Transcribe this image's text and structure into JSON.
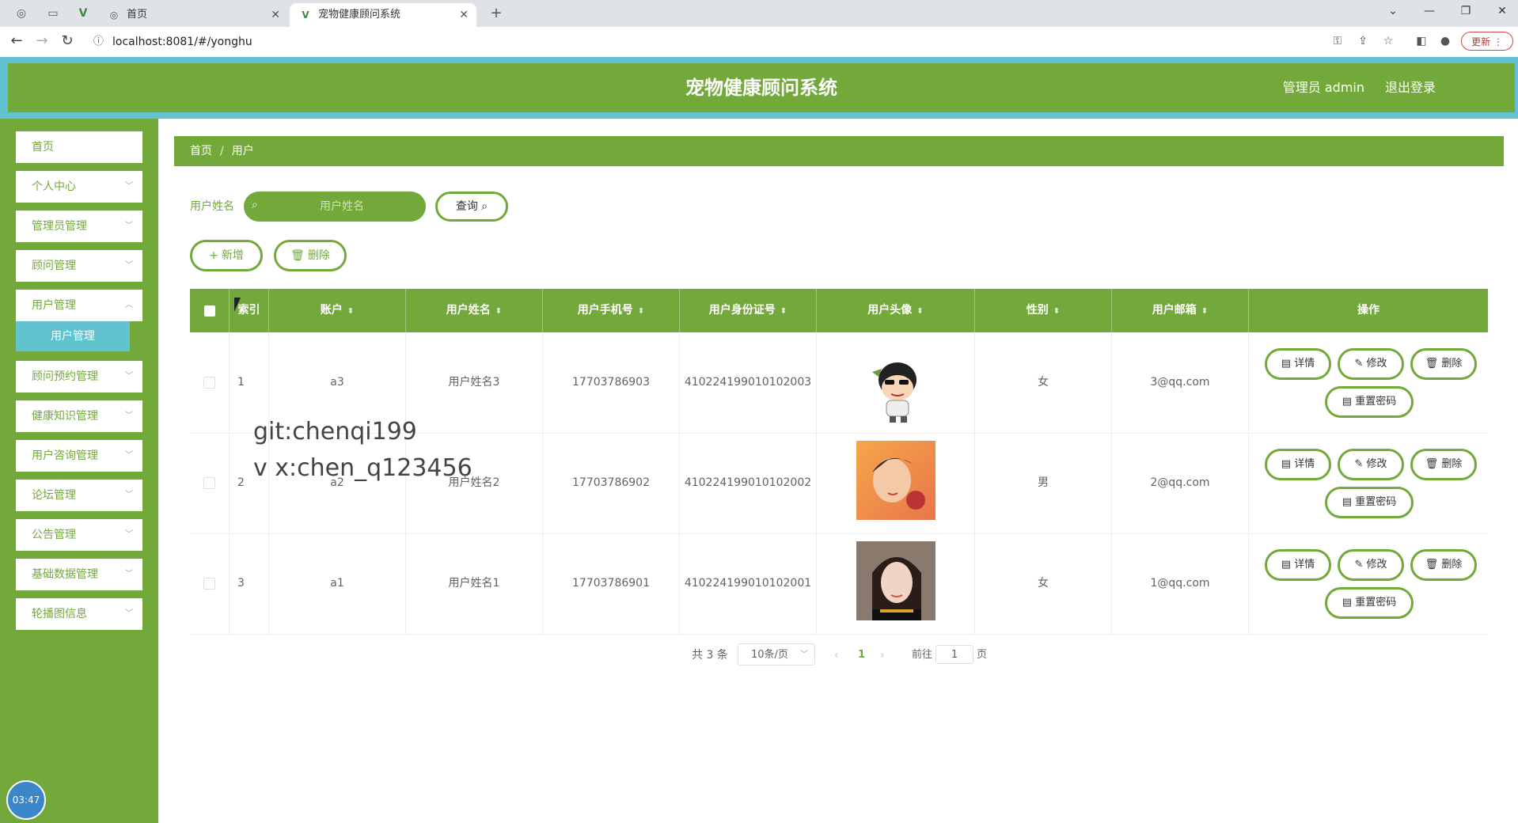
{
  "browser": {
    "tabs": [
      {
        "label": "首页"
      },
      {
        "label": "宠物健康顾问系统"
      }
    ],
    "url": "localhost:8081/#/yonghu",
    "update_label": "更新"
  },
  "header": {
    "title": "宠物健康顾问系统",
    "admin_label": "管理员 admin",
    "logout_label": "退出登录"
  },
  "sidebar": {
    "items": [
      {
        "label": "首页"
      },
      {
        "label": "个人中心"
      },
      {
        "label": "管理员管理"
      },
      {
        "label": "顾问管理"
      },
      {
        "label": "用户管理"
      },
      {
        "label": "顾问预约管理"
      },
      {
        "label": "健康知识管理"
      },
      {
        "label": "用户咨询管理"
      },
      {
        "label": "论坛管理"
      },
      {
        "label": "公告管理"
      },
      {
        "label": "基础数据管理"
      },
      {
        "label": "轮播图信息"
      }
    ],
    "submenu_label": "用户管理",
    "clock": "03:47"
  },
  "breadcrumb": {
    "home": "首页",
    "separator": "/",
    "current": "用户"
  },
  "search": {
    "label": "用户姓名",
    "placeholder": "用户姓名",
    "query_label": "查询"
  },
  "actions": {
    "add_label": "新增",
    "delete_label": "删除"
  },
  "table": {
    "headers": {
      "index": "索引",
      "account": "账户",
      "name": "用户姓名",
      "phone": "用户手机号",
      "id_number": "用户身份证号",
      "avatar": "用户头像",
      "gender": "性别",
      "email": "用户邮箱",
      "ops": "操作"
    },
    "rows": [
      {
        "index": "1",
        "account": "a3",
        "name": "用户姓名3",
        "phone": "17703786903",
        "id_number": "410224199010102003",
        "gender": "女",
        "email": "3@qq.com"
      },
      {
        "index": "2",
        "account": "a2",
        "name": "用户姓名2",
        "phone": "17703786902",
        "id_number": "410224199010102002",
        "gender": "男",
        "email": "2@qq.com"
      },
      {
        "index": "3",
        "account": "a1",
        "name": "用户姓名1",
        "phone": "17703786901",
        "id_number": "410224199010102001",
        "gender": "女",
        "email": "1@qq.com"
      }
    ],
    "row_actions": {
      "detail": "详情",
      "edit": "修改",
      "delete": "删除",
      "reset": "重置密码"
    }
  },
  "pagination": {
    "total": "共 3 条",
    "page_size": "10条/页",
    "current_page": "1",
    "goto_prefix": "前往",
    "goto_value": "1",
    "goto_suffix": "页"
  },
  "watermark": {
    "line1": "git:chenqi199",
    "line2": "v x:chen_q123456"
  },
  "colors": {
    "primary_green": "#73a83a",
    "accent_cyan": "#62c2d0"
  }
}
